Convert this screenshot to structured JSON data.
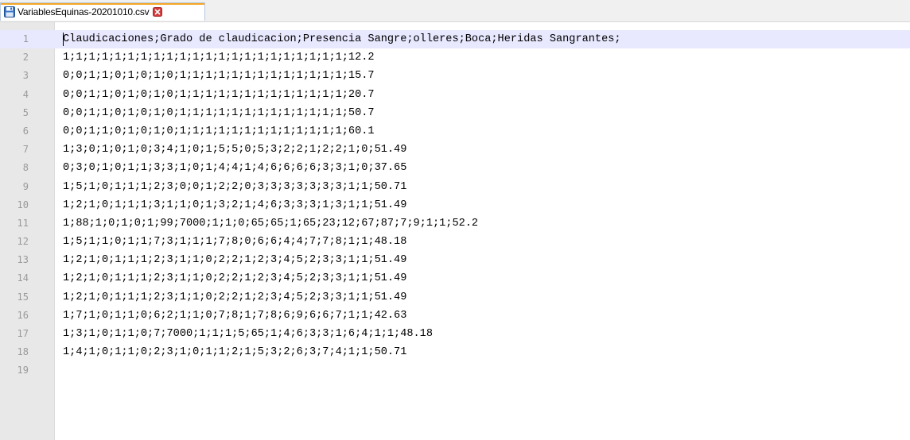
{
  "tab": {
    "filename": "VariablesEquinas-20201010.csv",
    "icon": "save-icon",
    "close_icon": "close-icon",
    "accent_color": "#f5a623",
    "close_color": "#d43c3c"
  },
  "editor": {
    "lines": [
      {
        "number": "1",
        "text": "Claudicaciones;Grado de claudicacion;Presencia Sangre;olleres;Boca;Heridas Sangrantes;"
      },
      {
        "number": "2",
        "text": "1;1;1;1;1;1;1;1;1;1;1;1;1;1;1;1;1;1;1;1;1;1;12.2"
      },
      {
        "number": "3",
        "text": "0;0;1;1;0;1;0;1;0;1;1;1;1;1;1;1;1;1;1;1;1;1;15.7"
      },
      {
        "number": "4",
        "text": "0;0;1;1;0;1;0;1;0;1;1;1;1;1;1;1;1;1;1;1;1;1;20.7"
      },
      {
        "number": "5",
        "text": "0;0;1;1;0;1;0;1;0;1;1;1;1;1;1;1;1;1;1;1;1;1;50.7"
      },
      {
        "number": "6",
        "text": "0;0;1;1;0;1;0;1;0;1;1;1;1;1;1;1;1;1;1;1;1;1;60.1"
      },
      {
        "number": "7",
        "text": "1;3;0;1;0;1;0;3;4;1;0;1;5;5;0;5;3;2;2;1;2;2;1;0;51.49"
      },
      {
        "number": "8",
        "text": "0;3;0;1;0;1;1;3;3;1;0;1;4;4;1;4;6;6;6;6;3;3;1;0;37.65"
      },
      {
        "number": "9",
        "text": "1;5;1;0;1;1;1;2;3;0;0;1;2;2;0;3;3;3;3;3;3;3;1;1;50.71"
      },
      {
        "number": "10",
        "text": "1;2;1;0;1;1;1;3;1;1;0;1;3;2;1;4;6;3;3;3;1;3;1;1;51.49"
      },
      {
        "number": "11",
        "text": "1;88;1;0;1;0;1;99;7000;1;1;0;65;65;1;65;23;12;67;87;7;9;1;1;52.2"
      },
      {
        "number": "12",
        "text": "1;5;1;1;0;1;1;7;3;1;1;1;7;8;0;6;6;4;4;7;7;8;1;1;48.18"
      },
      {
        "number": "13",
        "text": "1;2;1;0;1;1;1;2;3;1;1;0;2;2;1;2;3;4;5;2;3;3;1;1;51.49"
      },
      {
        "number": "14",
        "text": "1;2;1;0;1;1;1;2;3;1;1;0;2;2;1;2;3;4;5;2;3;3;1;1;51.49"
      },
      {
        "number": "15",
        "text": "1;2;1;0;1;1;1;2;3;1;1;0;2;2;1;2;3;4;5;2;3;3;1;1;51.49"
      },
      {
        "number": "16",
        "text": "1;7;1;0;1;1;0;6;2;1;1;0;7;8;1;7;8;6;9;6;6;7;1;1;42.63"
      },
      {
        "number": "17",
        "text": "1;3;1;0;1;1;0;7;7000;1;1;1;5;65;1;4;6;3;3;1;6;4;1;1;48.18"
      },
      {
        "number": "18",
        "text": "1;4;1;0;1;1;0;2;3;1;0;1;1;2;1;5;3;2;6;3;7;4;1;1;50.71"
      },
      {
        "number": "19",
        "text": ""
      }
    ],
    "current_line": 1
  }
}
